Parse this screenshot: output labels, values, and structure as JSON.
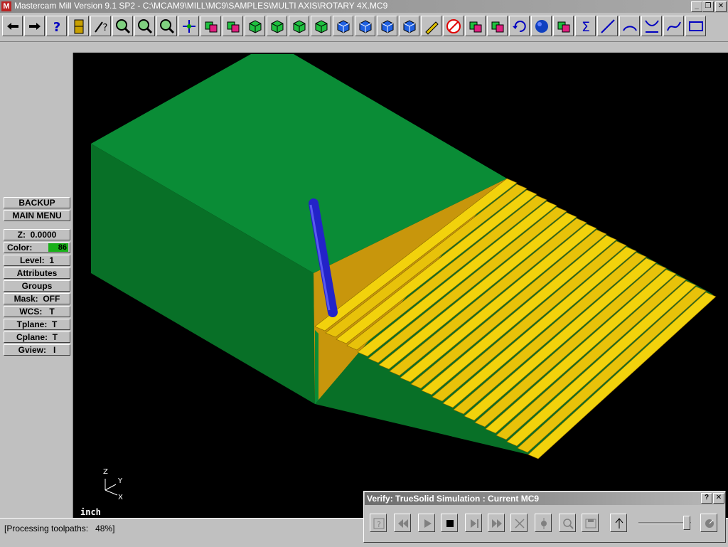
{
  "window": {
    "title": "Mastercam Mill Version 9.1 SP2 - C:\\MCAM9\\MILL\\MC9\\SAMPLES\\MULTI AXIS\\ROTARY 4X.MC9",
    "app_icon_letter": "M",
    "minimize_glyph": "_",
    "restore_glyph": "❐",
    "close_glyph": "✕"
  },
  "toolbar": {
    "icons": [
      "back-arrow-icon",
      "forward-arrow-icon",
      "help-icon",
      "file-cabinet-icon",
      "analyze-icon",
      "zoom-window-icon",
      "zoom-out-icon",
      "zoom-scale-icon",
      "pan-icon",
      "screen-select-icon",
      "dynamic-rotate-icon",
      "top-view-icon",
      "front-view-icon",
      "side-view-icon",
      "iso-view-icon",
      "cube-view-1-icon",
      "cube-view-2-icon",
      "cube-view-3-icon",
      "cube-view-4-icon",
      "pencil-icon",
      "no-entry-icon",
      "transform-icon",
      "multi-transform-icon",
      "undo-icon",
      "sphere-icon",
      "level-icon",
      "sum-icon",
      "line-icon",
      "arc-icon",
      "fillet-icon",
      "spline-icon",
      "rectangle-icon"
    ]
  },
  "sidebar": {
    "backup": "BACKUP",
    "main_menu": "MAIN MENU",
    "z": "Z:  0.0000",
    "color_label": "Color:",
    "color_value": "86",
    "level": "Level:  1",
    "attributes": "Attributes",
    "groups": "Groups",
    "mask": "Mask:  OFF",
    "wcs": "WCS:   T",
    "tplane": "Tplane:  T",
    "cplane": "Cplane:  T",
    "gview": "Gview:   I"
  },
  "viewport": {
    "units": "inch",
    "axis": {
      "z": "Z",
      "y": "Y",
      "x": "X"
    },
    "colors": {
      "stock_top": "#0a8c36",
      "stock_side": "#087027",
      "cut_face": "#c8960c",
      "ridges": "#f2d20c",
      "tool": "#2323c8"
    }
  },
  "status": {
    "text": "[Processing toolpaths:   48%]",
    "progress_percent": 48
  },
  "verify_dialog": {
    "title": "Verify: TrueSolid Simulation : Current MC9",
    "help_glyph": "?",
    "close_glyph": "✕",
    "buttons": [
      "options-icon",
      "rewind-icon",
      "play-icon",
      "stop-icon",
      "step-icon",
      "fast-forward-icon",
      "cut-icon",
      "tool-display-icon",
      "zoom-icon",
      "save-icon",
      "stock-icon",
      "speed-icon"
    ],
    "speed_fraction": 0.9
  }
}
